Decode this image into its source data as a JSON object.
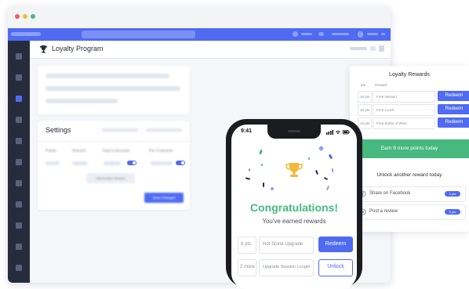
{
  "app": {
    "title": "Loyalty Program"
  },
  "settings": {
    "title": "Settings",
    "columns": [
      "Points",
      "Reward",
      "Total in Account",
      "Per Customer"
    ],
    "add_label": "Add Another Reward",
    "save_label": "Save Changes"
  },
  "phone": {
    "time": "9:41",
    "headline": "Congratulations!",
    "subline": "You've earned rewards",
    "rewards": [
      {
        "pts": "6 pts",
        "name": "Hot Stone Upgrade",
        "action": "Redeem"
      },
      {
        "pts": "2 more",
        "name": "Upgrade Session Length",
        "action": "Unlock"
      }
    ]
  },
  "panel": {
    "title": "Loyalty Rewards",
    "col_pts": "pts",
    "col_reward": "Reward",
    "rows": [
      {
        "pts": "16 pts",
        "name": "Free Dessert",
        "action": "Redeem"
      },
      {
        "pts": "10 pts",
        "name": "Free Lunch",
        "action": "Redeem"
      },
      {
        "pts": "16 pts",
        "name": "Free Bottle of Wine",
        "action": "Redeem"
      }
    ],
    "earn_text": "Earn 9 more points today",
    "unlock_title": "Unlock another reward today",
    "social": [
      {
        "label": "Share on Facebook",
        "badge": "2 pts"
      },
      {
        "label": "Post a review",
        "badge": "5 pts"
      }
    ]
  },
  "colors": {
    "accent": "#4f6bf2",
    "success": "#47b97f",
    "sidebar": "#262c3b",
    "gold": "#f2b93b"
  }
}
